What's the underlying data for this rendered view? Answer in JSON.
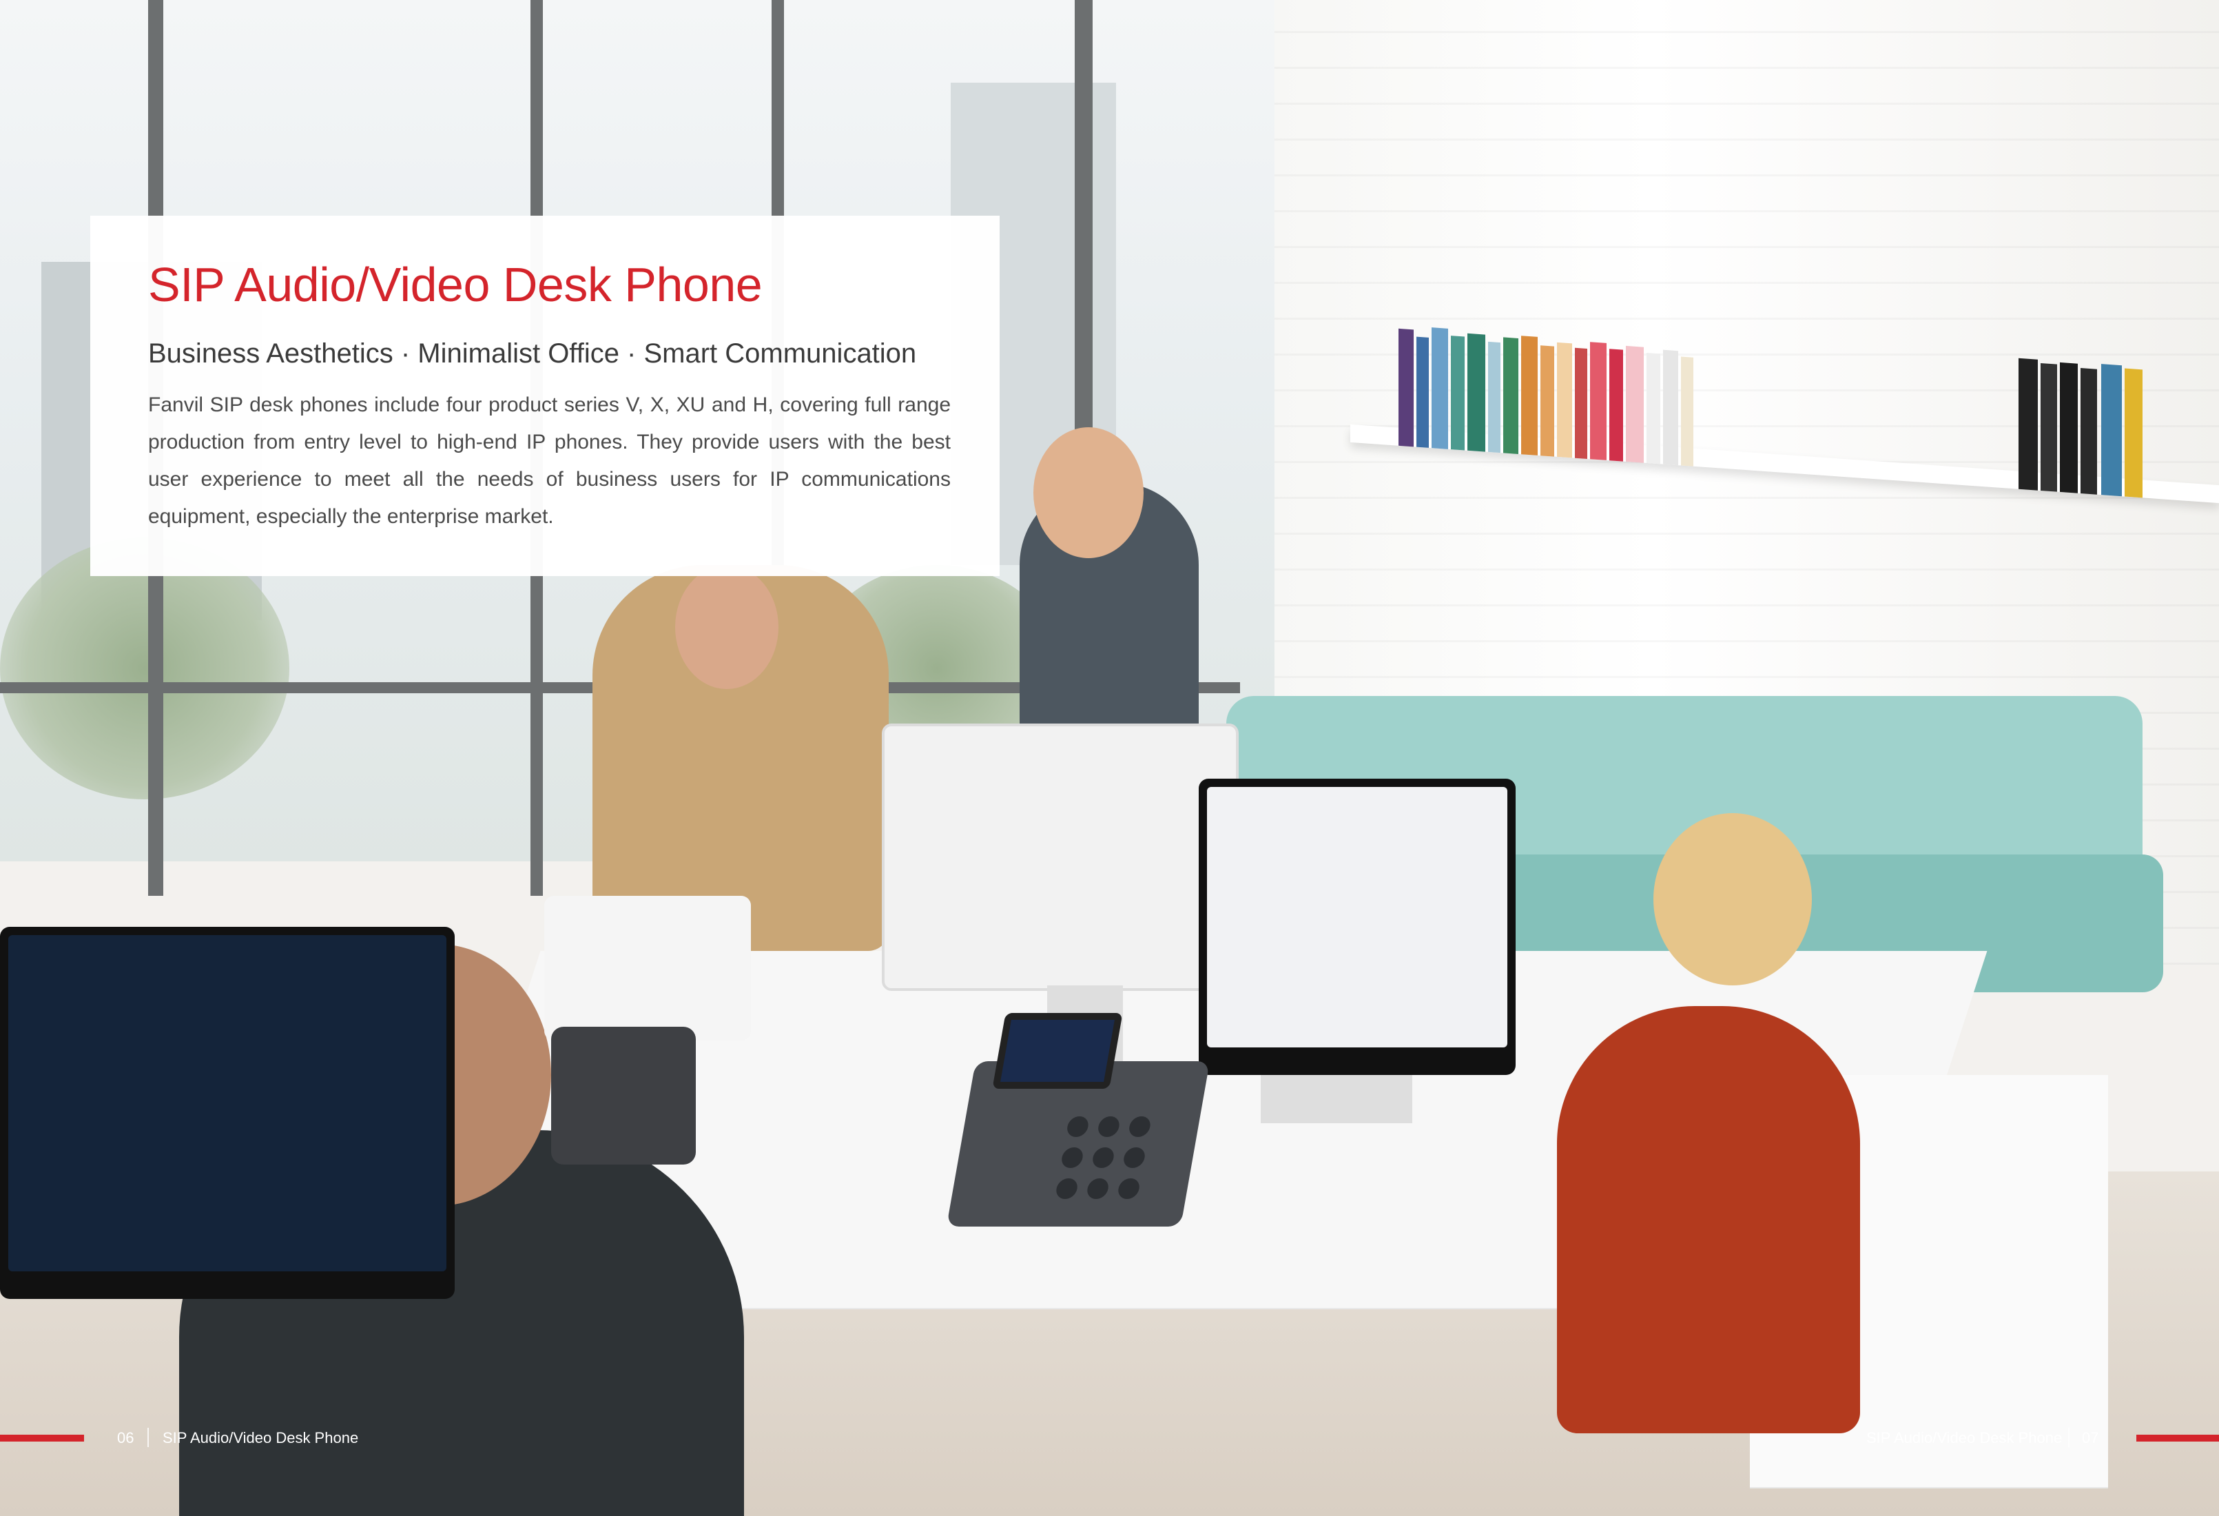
{
  "header": {
    "title": "SIP Audio/Video Desk Phone",
    "tagline": "Business Aesthetics · Minimalist Office · Smart Communication",
    "description": "Fanvil SIP desk phones include four product series V, X, XU and H, covering full range production from entry level to high-end IP phones. They provide users with the best user experience to meet all the needs of business users for IP communications equipment, especially the enterprise market."
  },
  "footer": {
    "left": {
      "page_number": "06",
      "label": "SIP Audio/Video Desk Phone"
    },
    "right": {
      "page_number": "07",
      "label": "SIP Audio/Video Desk Phone"
    }
  },
  "colors": {
    "brand_red": "#d4242b",
    "text_dark": "#3a3a3a",
    "panel_bg": "#ffffff",
    "sofa_teal": "#8cc7c1"
  }
}
